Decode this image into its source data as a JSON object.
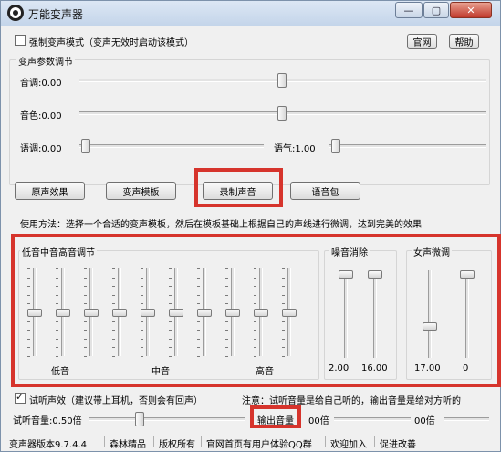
{
  "window": {
    "title": "万能变声器",
    "controls": [
      "—",
      "▢",
      "✕"
    ]
  },
  "top": {
    "force_checkbox_label": "强制变声模式（变声无效时启动该模式）",
    "official_site_button": "官网",
    "help_button": "帮助",
    "force_checked": false
  },
  "params": {
    "group_title": "变声参数调节",
    "pitch": {
      "label": "音调:0.00",
      "position": 0.5
    },
    "timbre": {
      "label": "音色:0.00",
      "position": 0.5
    },
    "speed": {
      "label": "语调:0.00",
      "position": 0.0
    },
    "tone": {
      "label": "语气:1.00",
      "position": 0.0
    }
  },
  "buttons": {
    "original": "原声效果",
    "templates": "变声模板",
    "record": "录制声音",
    "voice_pack": "语音包"
  },
  "instructions": "使用方法：选择一个合适的变声模板，然后在模板基础上根据自己的声线进行微调，达到完美的效果",
  "eq": {
    "group_title": "低音中音高音调节",
    "bands": 10,
    "levels": [
      0.5,
      0.5,
      0.5,
      0.5,
      0.5,
      0.5,
      0.5,
      0.5,
      0.5,
      0.5
    ],
    "low_label": "低音",
    "mid_label": "中音",
    "high_label": "高音"
  },
  "noise": {
    "group_title": "噪音消除",
    "values": [
      "2.00",
      "16.00"
    ],
    "levels": [
      1.0,
      1.0
    ]
  },
  "female": {
    "group_title": "女声微调",
    "values": [
      "17.00",
      "0"
    ],
    "levels": [
      0.35,
      1.0
    ]
  },
  "monitor": {
    "checkbox_label": "试听声效（建议带上耳机，否则会有回声）",
    "checked": true,
    "note": "注意：试听音量是给自己听的，输出音量是给对方听的"
  },
  "volume": {
    "monitor_label": "试听音量:0.50倍",
    "monitor_level": 0.5,
    "output_label": "输出音量",
    "output_value": "00倍",
    "output_value2": "00倍"
  },
  "status": [
    "变声器版本9.7.4.4",
    "森林精品",
    "版权所有",
    "官网首页有用户体验QQ群",
    "欢迎加入",
    "促进改善"
  ]
}
